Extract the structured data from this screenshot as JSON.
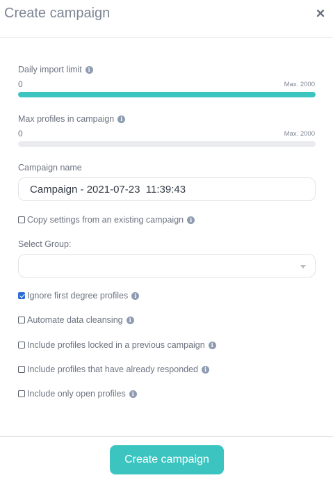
{
  "dialog": {
    "title": "Create campaign",
    "close_icon": "close-icon"
  },
  "daily_import": {
    "label": "Daily import limit",
    "value": "0",
    "max_label": "Max. 2000",
    "fill_fraction": 1.0,
    "fill_color": "#3cc5c0"
  },
  "max_profiles": {
    "label": "Max profiles in campaign",
    "value": "0",
    "max_label": "Max. 2000",
    "fill_fraction": 0,
    "fill_color": "#3cc5c0"
  },
  "campaign_name": {
    "label": "Campaign name",
    "value": "Campaign - 2021-07-23  11:39:43"
  },
  "copy_settings": {
    "label": "Copy settings from an existing campaign",
    "checked": false
  },
  "select_group": {
    "label": "Select Group:",
    "value": ""
  },
  "options": [
    {
      "label": "Ignore first degree profiles",
      "checked": true
    },
    {
      "label": "Automate data cleansing",
      "checked": false
    },
    {
      "label": "Include profiles locked in a previous campaign",
      "checked": false
    },
    {
      "label": "Include profiles that have already responded",
      "checked": false
    },
    {
      "label": "Include only open profiles",
      "checked": false
    }
  ],
  "footer": {
    "submit_label": "Create campaign"
  },
  "colors": {
    "accent": "#3cc5c0",
    "checkbox_checked": "#2c6cd6",
    "info_icon": "#8e9bb0"
  }
}
